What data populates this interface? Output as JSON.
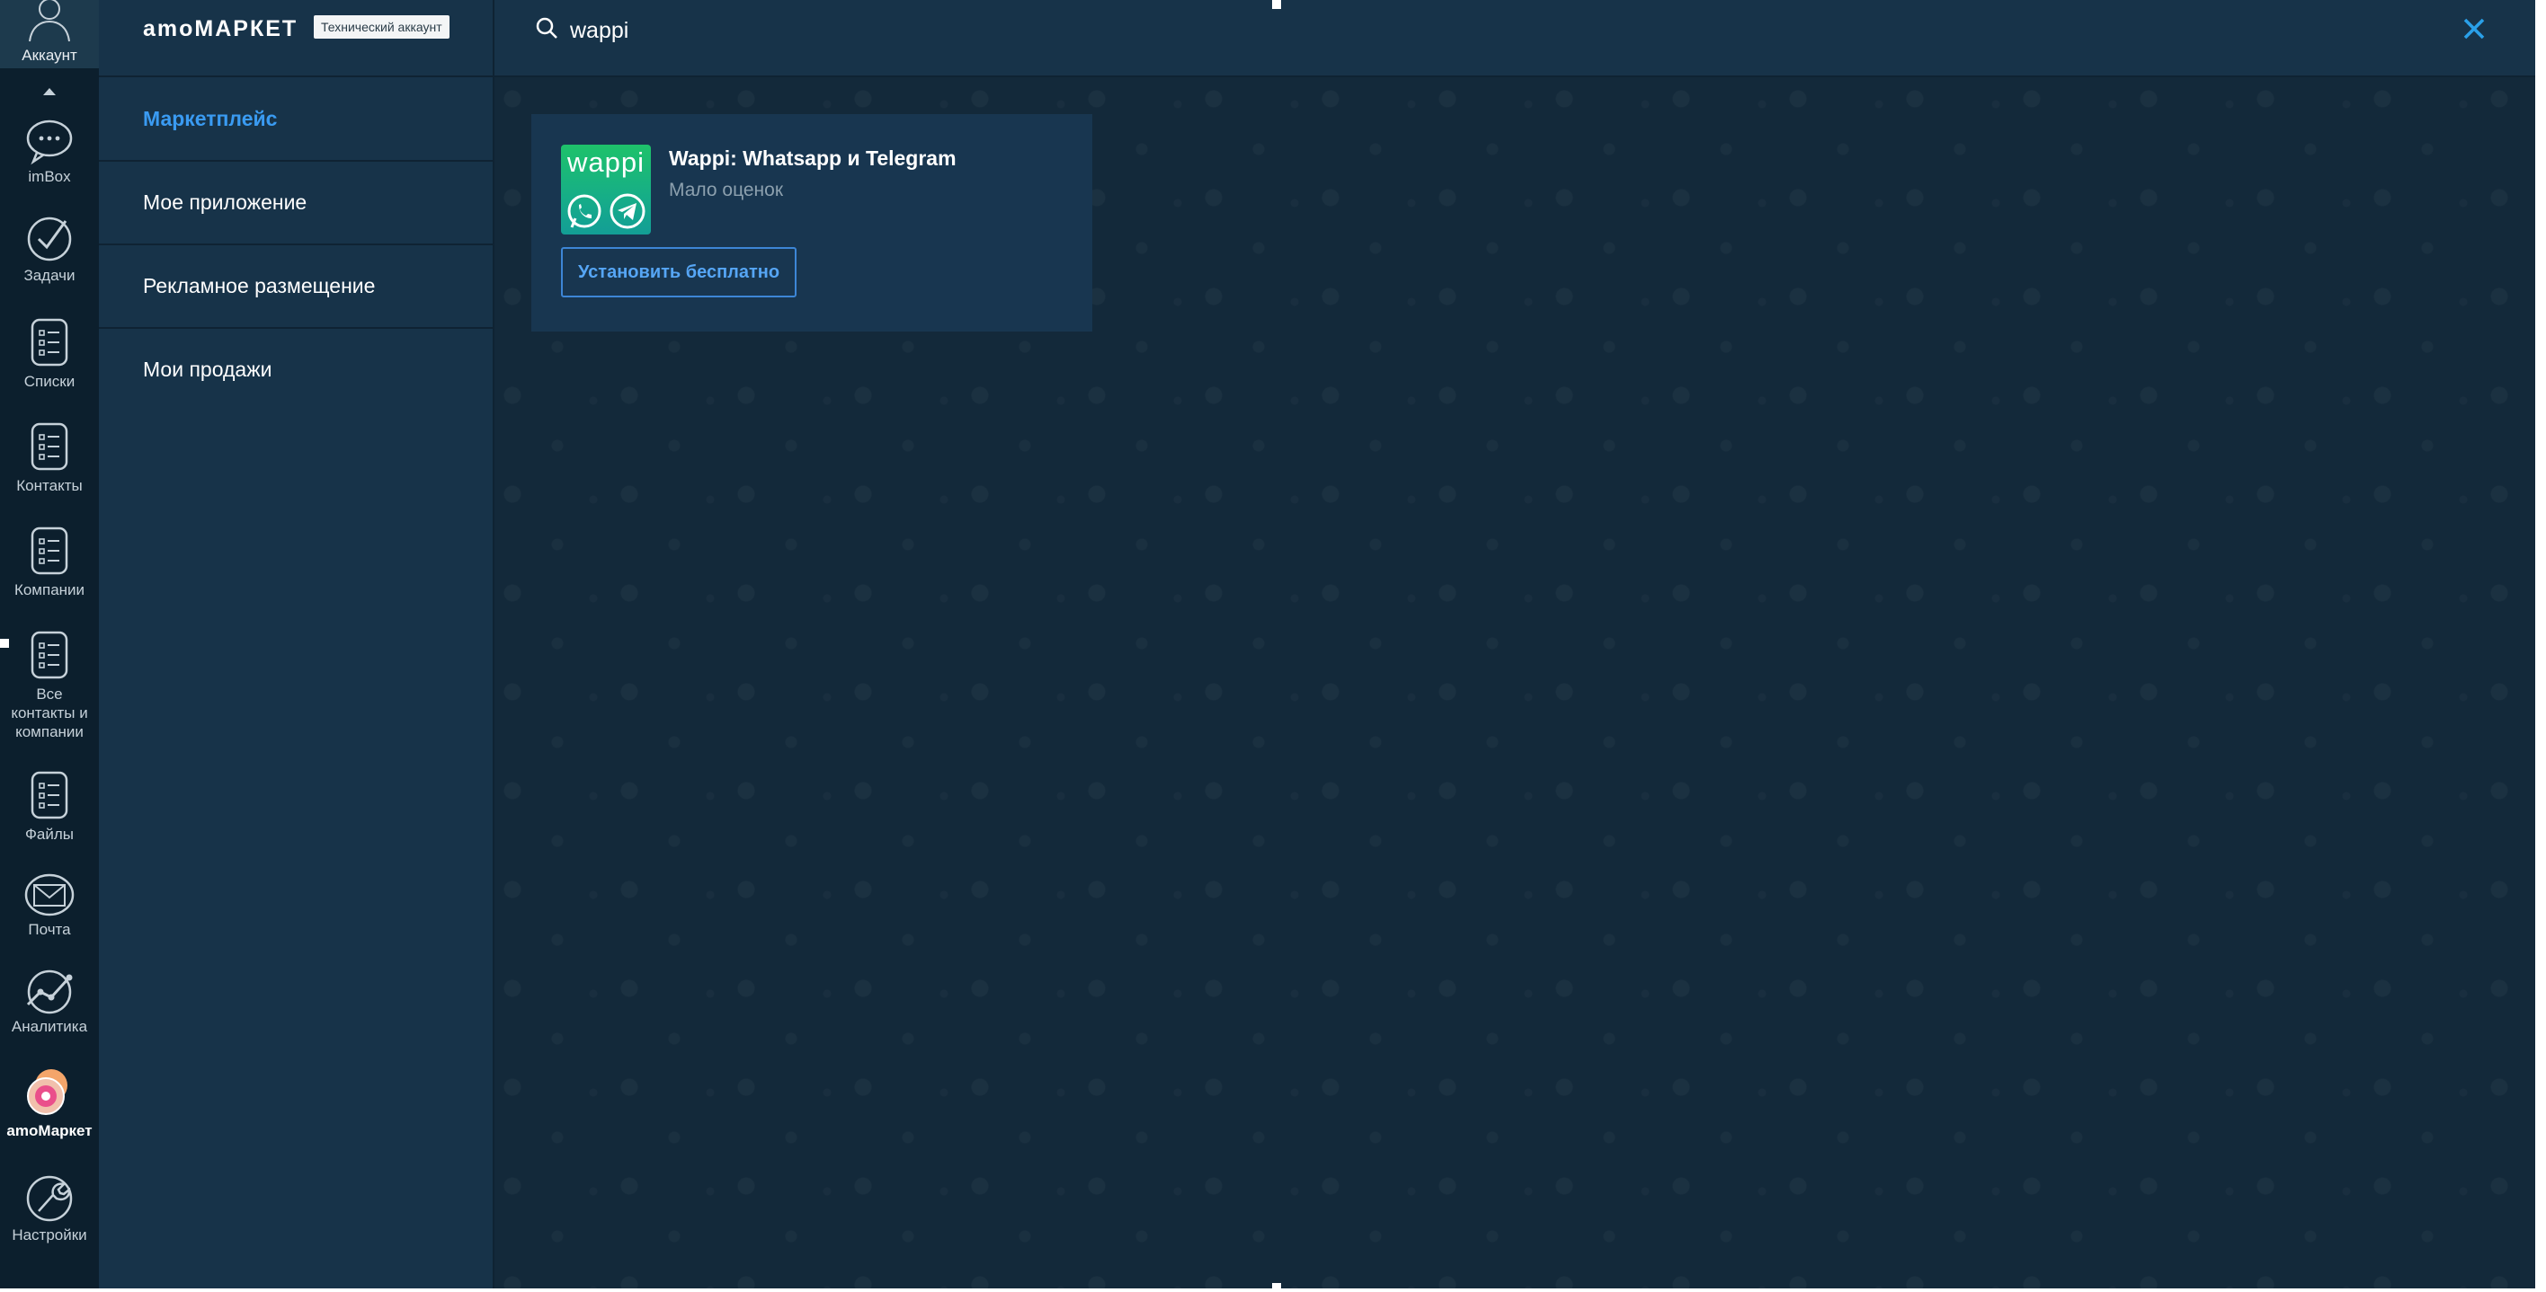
{
  "rail": {
    "account_label": "Аккаунт",
    "items": [
      {
        "label": "imBox",
        "icon": "chat-bubble-icon"
      },
      {
        "label": "Задачи",
        "icon": "check-circle-icon"
      },
      {
        "label": "Списки",
        "icon": "list-icon"
      },
      {
        "label": "Контакты",
        "icon": "list-icon"
      },
      {
        "label": "Компании",
        "icon": "list-icon"
      },
      {
        "label": "Все контакты и компании",
        "icon": "list-icon"
      },
      {
        "label": "Файлы",
        "icon": "list-icon"
      },
      {
        "label": "Почта",
        "icon": "mail-icon"
      },
      {
        "label": "Аналитика",
        "icon": "analytics-icon"
      },
      {
        "label": "amoМаркет",
        "icon": "amomarket-icon",
        "active": true
      },
      {
        "label": "Настройки",
        "icon": "wrench-icon"
      }
    ]
  },
  "menu": {
    "brand": "amoМАРКЕТ",
    "badge": "Технический аккаунт",
    "items": [
      {
        "label": "Маркетплейс",
        "active": true
      },
      {
        "label": "Мое приложение"
      },
      {
        "label": "Рекламное размещение"
      },
      {
        "label": "Мои продажи"
      }
    ]
  },
  "search": {
    "value": "wappi",
    "icon": "search-icon",
    "close_icon": "close-icon"
  },
  "results": [
    {
      "logo_text": "wappi",
      "title": "Wappi: Whatsapp и Telegram",
      "rating": "Мало оценок",
      "button": "Установить бесплатно",
      "logo_icons": [
        "whatsapp-icon",
        "telegram-icon"
      ]
    }
  ],
  "colors": {
    "rail_bg": "#0c1f2d",
    "menu_bg": "#173349",
    "content_bg": "#13293a",
    "accent": "#3a9bf2",
    "close": "#2aa0e8",
    "logo_green": "#1ec26a"
  }
}
